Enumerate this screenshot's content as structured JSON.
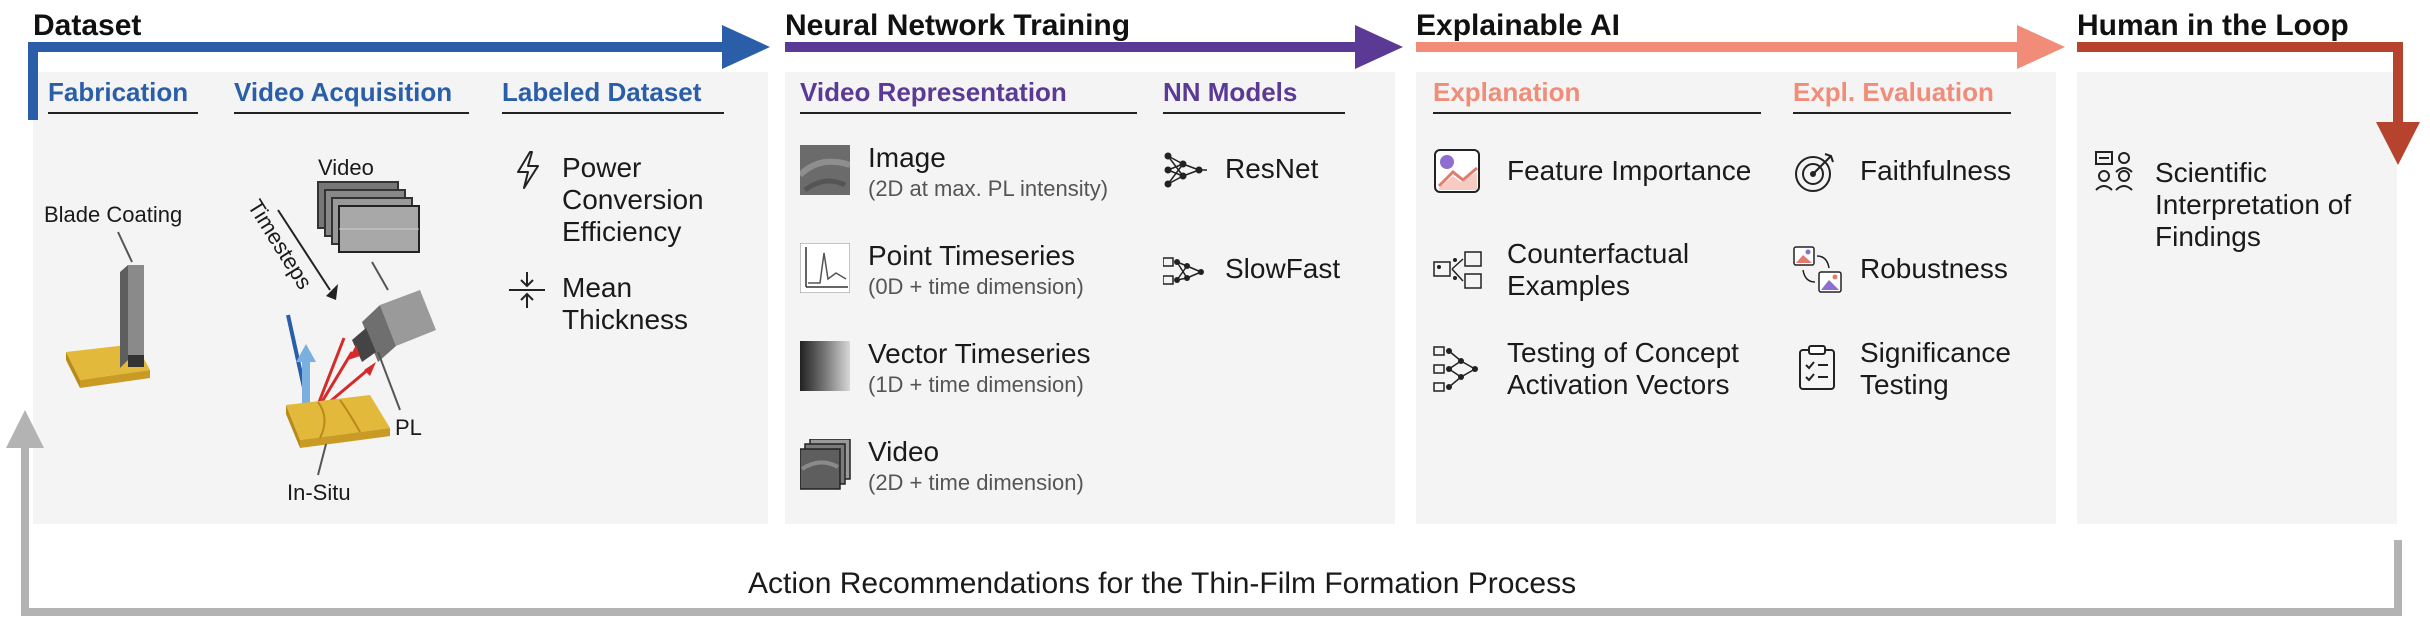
{
  "stages": {
    "dataset": "Dataset",
    "training": "Neural Network Training",
    "xai": "Explainable AI",
    "human": "Human in the Loop"
  },
  "dataset": {
    "fabrication": "Fabrication",
    "video_acquisition": "Video Acquisition",
    "labeled_dataset": "Labeled Dataset",
    "blade_coating": "Blade Coating",
    "video": "Video",
    "timesteps": "Timesteps",
    "pl": "PL",
    "in_situ": "In-Situ",
    "labels": [
      "Power Conversion Efficiency",
      "Mean Thickness"
    ]
  },
  "training": {
    "video_representation": "Video Representation",
    "nn_models": "NN Models",
    "representations": [
      {
        "name": "Image",
        "detail": "(2D at max. PL intensity)"
      },
      {
        "name": "Point Timeseries",
        "detail": "(0D + time dimension)"
      },
      {
        "name": "Vector Timeseries",
        "detail": "(1D + time dimension)"
      },
      {
        "name": "Video",
        "detail": "(2D + time dimension)"
      }
    ],
    "models": [
      "ResNet",
      "SlowFast"
    ]
  },
  "xai": {
    "explanation": "Explanation",
    "evaluation": "Expl. Evaluation",
    "methods": [
      "Feature Importance",
      "Counterfactual Examples",
      "Testing of Concept Activation Vectors"
    ],
    "evaluations": [
      "Faithfulness",
      "Robustness",
      "Significance Testing"
    ]
  },
  "human": {
    "finding": "Scientific Interpretation of Findings"
  },
  "feedback": "Action Recommendations for the Thin-Film Formation Process",
  "colors": {
    "dataset": "#2a5ea8",
    "training": "#5b3a96",
    "xai": "#f08c78",
    "human": "#b5432d",
    "feedback": "#b3b3b3"
  }
}
